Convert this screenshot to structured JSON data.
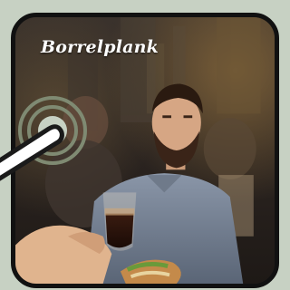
{
  "card": {
    "title": "Borrelplank"
  },
  "icons": {
    "pointer": "tap-pointer-icon"
  },
  "colors": {
    "page_background": "#c7d1c3",
    "card_border": "#111111",
    "title_text": "#ffffff",
    "ripple": "#7f8a72"
  }
}
